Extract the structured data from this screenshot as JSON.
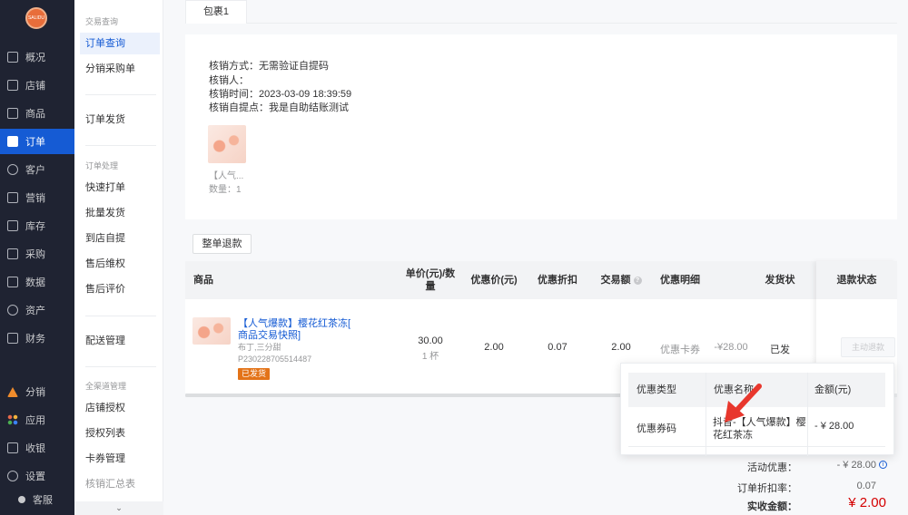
{
  "nav": {
    "logo_text": "SALIDU",
    "items": [
      {
        "label": "概况",
        "icon": "overview-icon"
      },
      {
        "label": "店铺",
        "icon": "shop-icon"
      },
      {
        "label": "商品",
        "icon": "goods-icon"
      },
      {
        "label": "订单",
        "icon": "order-icon"
      },
      {
        "label": "客户",
        "icon": "customer-icon"
      },
      {
        "label": "营销",
        "icon": "gift-icon"
      },
      {
        "label": "库存",
        "icon": "warehouse-icon"
      },
      {
        "label": "采购",
        "icon": "purchase-icon"
      },
      {
        "label": "数据",
        "icon": "data-icon"
      },
      {
        "label": "资产",
        "icon": "asset-icon"
      },
      {
        "label": "财务",
        "icon": "finance-icon"
      },
      {
        "label": "分销",
        "icon": "distribution-icon"
      },
      {
        "label": "应用",
        "icon": "apps-icon"
      },
      {
        "label": "收银",
        "icon": "cashier-icon"
      },
      {
        "label": "设置",
        "icon": "settings-icon"
      }
    ],
    "active": "订单",
    "kefu": "客服"
  },
  "subnav": {
    "group1": "交易查询",
    "item_order_query": "订单查询",
    "item_dist_purchase": "分销采购单",
    "item_order_ship": "订单发货",
    "group2": "订单处理",
    "item_quick_print": "快速打单",
    "item_batch_ship": "批量发货",
    "item_pickup": "到店自提",
    "item_aftersale": "售后维权",
    "item_review": "售后评价",
    "item_delivery": "配送管理",
    "group3": "全渠道管理",
    "item_store_auth": "店铺授权",
    "item_auth_list": "授权列表",
    "item_coupon_mgmt": "卡券管理",
    "item_verify_summary": "核销汇总表"
  },
  "package_tab": "包裹1",
  "verify": {
    "method": "核销方式：无需验证自提码",
    "person": "核销人：",
    "time": "核销时间：2023-03-09 18:39:59",
    "pickup_point": "核销自提点：我是自助结账测试"
  },
  "thumb_caption": "【人气...",
  "thumb_qty": "数量：1",
  "refund_all_button": "整单退款",
  "table": {
    "headers": {
      "goods": "商品",
      "unit_price": "单价(元)/数量",
      "discount_price": "优惠价(元)",
      "discount_rate": "优惠折扣",
      "trade_amount": "交易额",
      "discount_detail": "优惠明细",
      "ship_status": "发货状",
      "refund_status": "退款状态"
    },
    "row": {
      "title": "【人气爆款】樱花红茶冻[",
      "snapshot": "商品交易快照]",
      "spec": "布丁,三分甜",
      "code": "P230228705514487",
      "tag": "已发货",
      "unit_price": "30.00",
      "qty": "1 杯",
      "discount_price": "2.00",
      "discount_rate": "0.07",
      "trade_amount": "2.00",
      "discount_type": "优惠卡券",
      "discount_amount": "-¥28.00",
      "ship_status": "已发",
      "refund_button": "主动退款"
    }
  },
  "popover": {
    "headers": {
      "type": "优惠类型",
      "name": "优惠名称",
      "amount": "金额(元)"
    },
    "row": {
      "type": "优惠券码",
      "name_line1": "抖音-【人气爆款】樱",
      "name_line2": "花红茶冻",
      "amount": "- ¥ 28.00"
    }
  },
  "summary": {
    "activity_label": "活动优惠：",
    "activity_value": "- ¥ 28.00",
    "rate_label": "订单折扣率：",
    "rate_value": "0.07",
    "total_label": "实收金额：",
    "total_value": "¥ 2.00"
  },
  "colors": {
    "accent": "#155bd4",
    "nav_bg": "#1f2332",
    "tag": "#e37318",
    "total": "#d40000",
    "arrow": "#e8372d"
  }
}
